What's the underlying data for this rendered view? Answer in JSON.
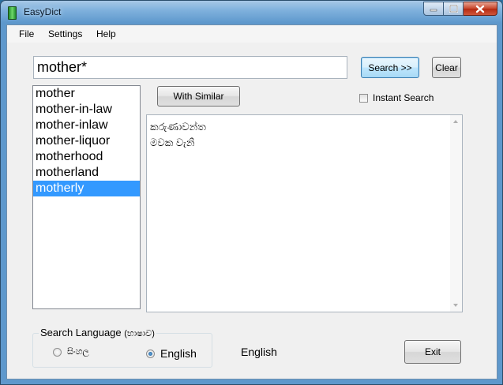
{
  "window": {
    "title": "EasyDict"
  },
  "menu": [
    "File",
    "Settings",
    "Help"
  ],
  "search": {
    "value": "mother*",
    "search_label": "Search >>",
    "clear_label": "Clear"
  },
  "with_similar_label": "With Similar",
  "instant_search": {
    "label": "Instant Search",
    "checked": false
  },
  "word_list": {
    "items": [
      "mother",
      "mother-in-law",
      "mother-inlaw",
      "mother-liquor",
      "motherhood",
      "motherland",
      "motherly"
    ],
    "selected": "motherly"
  },
  "results": [
    "කරුණාවන්ත",
    "මවක වැනි"
  ],
  "search_language": {
    "legend": "Search Language",
    "legend_sinhala": "(භාෂාව)",
    "options": [
      {
        "label": "සිංහල",
        "checked": false
      },
      {
        "label": "English",
        "checked": true
      }
    ],
    "current": "English"
  },
  "exit_label": "Exit",
  "colors": {
    "selection": "#3399ff",
    "titlebar": "#7fb1dd"
  }
}
